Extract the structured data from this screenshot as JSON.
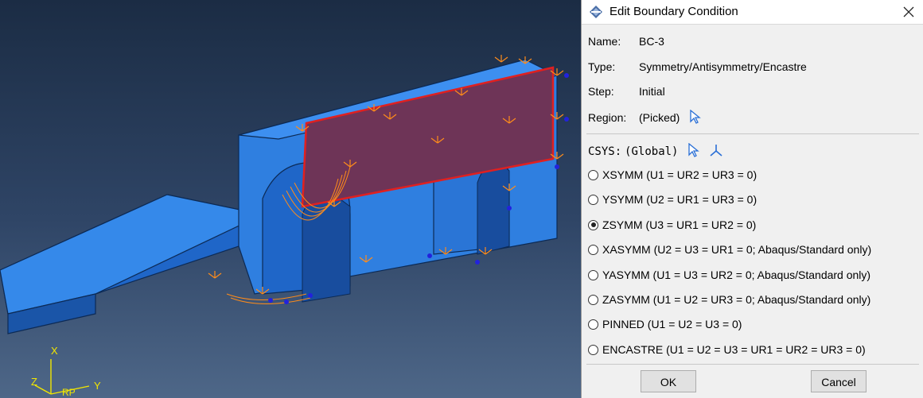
{
  "dialog": {
    "title": "Edit Boundary Condition",
    "name_label": "Name:",
    "name_value": "BC-3",
    "type_label": "Type:",
    "type_value": "Symmetry/Antisymmetry/Encastre",
    "step_label": "Step:",
    "step_value": "Initial",
    "region_label": "Region:",
    "region_value": "(Picked)",
    "csys_label": "CSYS:",
    "csys_value": "(Global)",
    "options": [
      {
        "label": "XSYMM (U1 = UR2 = UR3 = 0)",
        "selected": false
      },
      {
        "label": "YSYMM (U2 = UR1 = UR3 = 0)",
        "selected": false
      },
      {
        "label": "ZSYMM (U3 = UR1 = UR2 = 0)",
        "selected": true
      },
      {
        "label": "XASYMM (U2 = U3 = UR1 = 0; Abaqus/Standard only)",
        "selected": false
      },
      {
        "label": "YASYMM (U1 = U3 = UR2 = 0; Abaqus/Standard only)",
        "selected": false
      },
      {
        "label": "ZASYMM (U1 = U2 = UR3 = 0; Abaqus/Standard only)",
        "selected": false
      },
      {
        "label": "PINNED (U1 = U2 = U3 = 0)",
        "selected": false
      },
      {
        "label": "ENCASTRE (U1 = U2 = U3 = UR1 = UR2 = UR3 = 0)",
        "selected": false
      }
    ],
    "ok_label": "OK",
    "cancel_label": "Cancel"
  },
  "viewport": {
    "triad": {
      "x": "X",
      "y": "Y",
      "z": "Z",
      "rp": "RP"
    },
    "colors": {
      "part": "#2f7fe0",
      "part_dark": "#1c5db8",
      "selected_face": "#6e3457",
      "edge": "#e02020",
      "bc_marker": "#ff8c1a",
      "bc_marker_base": "#2222dd",
      "triad": "#f2e600"
    }
  }
}
